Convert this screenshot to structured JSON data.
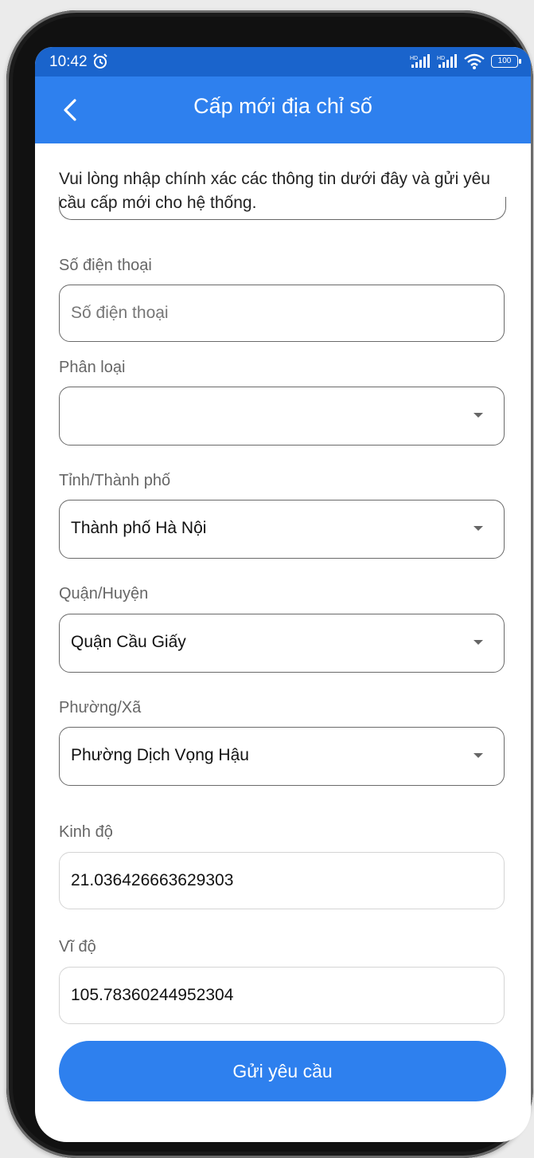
{
  "status_bar": {
    "time": "10:42",
    "battery": "100"
  },
  "app_bar": {
    "title": "Cấp mới địa chỉ số"
  },
  "intro_text": "Vui lòng nhập chính xác các thông tin dưới đây và gửi yêu cầu cấp mới cho hệ thống.",
  "form": {
    "phone": {
      "label": "Số điện thoại",
      "placeholder": "Số điện thoại",
      "value": ""
    },
    "category": {
      "label": "Phân loại",
      "value": ""
    },
    "province": {
      "label": "Tỉnh/Thành phố",
      "value": "Thành phố Hà Nội"
    },
    "district": {
      "label": "Quận/Huyện",
      "value": "Quận Cầu Giấy"
    },
    "ward": {
      "label": "Phường/Xã",
      "value": "Phường Dịch Vọng Hậu"
    },
    "longitude": {
      "label": "Kinh độ",
      "value": "21.036426663629303"
    },
    "latitude": {
      "label": "Vĩ độ",
      "value": "105.78360244952304"
    }
  },
  "submit_label": "Gửi yêu cầu",
  "colors": {
    "primary": "#2e80ee",
    "status_bar": "#1a64cc"
  }
}
